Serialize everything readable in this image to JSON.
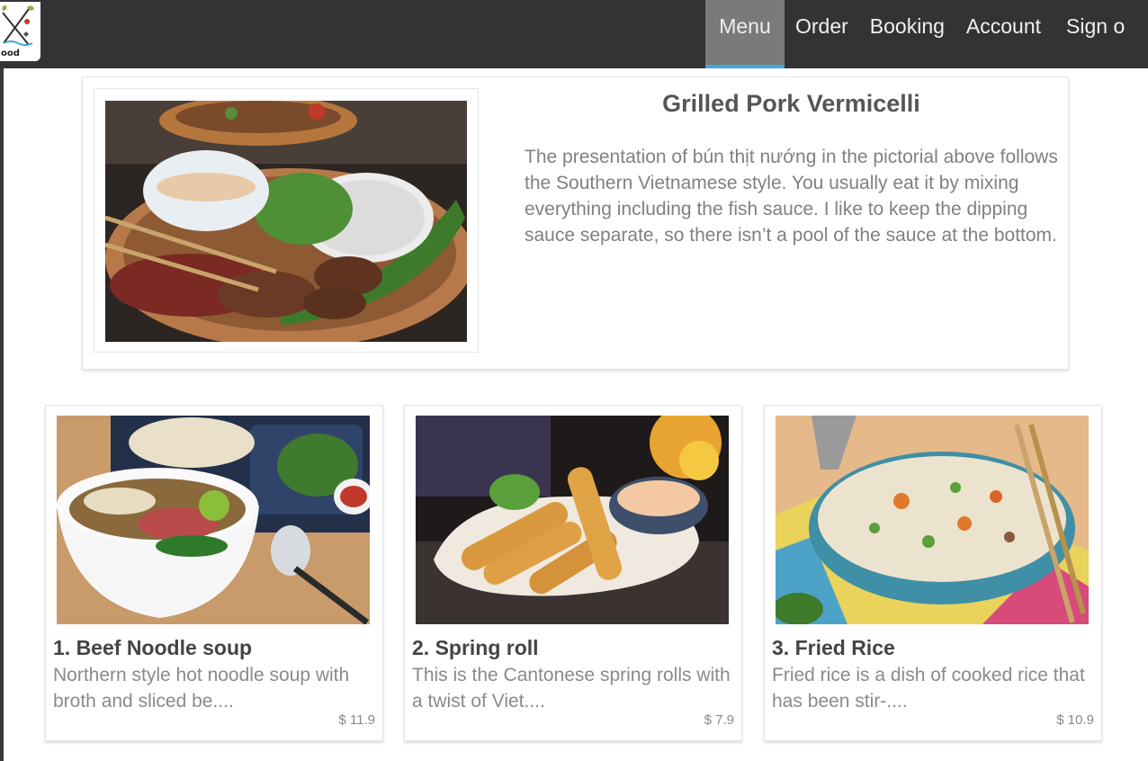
{
  "logo": {
    "text": "ood"
  },
  "nav": {
    "items": [
      {
        "label": "Menu",
        "active": true
      },
      {
        "label": "Order",
        "active": false
      },
      {
        "label": "Booking",
        "active": false
      },
      {
        "label": "Account",
        "active": false
      },
      {
        "label": "Sign ou",
        "active": false
      }
    ]
  },
  "featured": {
    "title": "Grilled Pork Vermicelli",
    "description": "The presentation of bún thịt nướng in the pictorial above follows the Southern Vietnamese style. You usually eat it by mixing everything including the fish sauce. I like to keep the dipping sauce separate, so there isn’t a pool of the sauce at the bottom.",
    "image_icon": "grilled-pork-vermicelli-photo"
  },
  "menu_items": [
    {
      "title": "1. Beef Noodle soup",
      "description": "Northern style hot noodle soup with broth and sliced be....",
      "price": "$ 11.9",
      "image_icon": "beef-noodle-soup-photo"
    },
    {
      "title": "2. Spring roll",
      "description": "This is the Cantonese spring rolls with a twist of Viet....",
      "price": "$ 7.9",
      "image_icon": "spring-roll-photo"
    },
    {
      "title": "3. Fried Rice",
      "description": "Fried rice is a dish of cooked rice that has been stir-....",
      "price": "$ 10.9",
      "image_icon": "fried-rice-photo"
    }
  ],
  "colors": {
    "navbar": "#333333",
    "nav_active": "#7a7a7a",
    "nav_active_underline": "#3ea8d6"
  }
}
